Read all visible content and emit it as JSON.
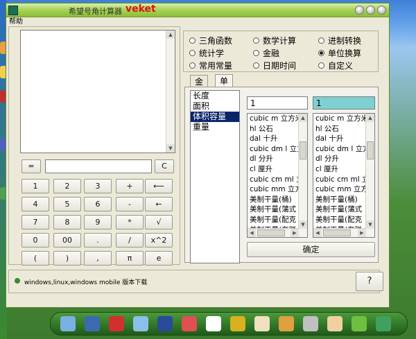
{
  "window": {
    "title": "希望号角计算器",
    "brand": "veket",
    "menu_help": "帮助"
  },
  "calculator": {
    "eq_button": "=",
    "clear_button": "C",
    "keys": [
      [
        "1",
        "2",
        "3",
        "+",
        "⟵"
      ],
      [
        "4",
        "5",
        "6",
        "-",
        "←"
      ],
      [
        "7",
        "8",
        "9",
        "*",
        "√"
      ],
      [
        "0",
        "00",
        ".",
        "/",
        "x^2"
      ],
      [
        "(",
        ")",
        ",",
        "π",
        "e"
      ]
    ]
  },
  "modes": [
    {
      "label": "三角函数",
      "selected": false
    },
    {
      "label": "数学计算",
      "selected": false
    },
    {
      "label": "进制转换",
      "selected": false
    },
    {
      "label": "统计学",
      "selected": false
    },
    {
      "label": "金融",
      "selected": false
    },
    {
      "label": "单位换算",
      "selected": true
    },
    {
      "label": "常用常量",
      "selected": false
    },
    {
      "label": "日期时间",
      "selected": false
    },
    {
      "label": "自定义",
      "selected": false
    }
  ],
  "tabs": [
    "金融",
    "单位换算"
  ],
  "categories": [
    "长度",
    "面积",
    "体积容量",
    "重量"
  ],
  "selected_category": "体积容量",
  "converter": {
    "left_value": "1",
    "right_value": "1",
    "units_left": [
      "cubic m 立方米",
      "hl 公石",
      "dal 十升",
      "cubic dm l 立方",
      "dl 分升",
      "cl 厘升",
      "cubic cm ml 立",
      "cubic mm 立方",
      "美制干量(桶)",
      "美制干量(蒲式",
      "美制干量(配克",
      "美制干量(夸脱"
    ],
    "units_right": [
      "cubic m 立方米",
      "hl 公石",
      "dal 十升",
      "cubic dm l 立方",
      "dl 分升",
      "cl 厘升",
      "cubic cm ml 立",
      "cubic mm 立方",
      "美制干量(桶)",
      "美制干量(蒲式",
      "美制干量(配克",
      "美制干量(夸脱"
    ],
    "confirm_label": "确定"
  },
  "status": {
    "text": "windows,linux,windows mobile 版本下载",
    "help_label": "?"
  },
  "colors": {
    "titlebar": "#a9d45a",
    "brand": "#e01010",
    "window_bg": "#ece9d8",
    "selection": "#0a246a",
    "right_input_bg": "#7fd0d0"
  }
}
